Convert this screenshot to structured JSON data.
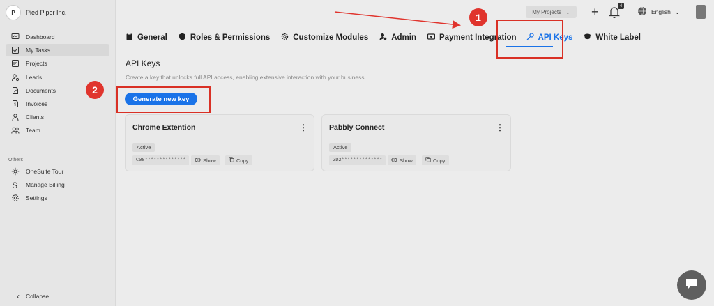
{
  "brand": {
    "logo_text": "P",
    "name": "Pied Piper Inc."
  },
  "sidebar": {
    "items": [
      {
        "label": "Dashboard",
        "icon": "dashboard-icon"
      },
      {
        "label": "My Tasks",
        "icon": "tasks-icon"
      },
      {
        "label": "Projects",
        "icon": "projects-icon"
      },
      {
        "label": "Leads",
        "icon": "leads-icon"
      },
      {
        "label": "Documents",
        "icon": "documents-icon"
      },
      {
        "label": "Invoices",
        "icon": "invoices-icon"
      },
      {
        "label": "Clients",
        "icon": "clients-icon"
      },
      {
        "label": "Team",
        "icon": "team-icon"
      }
    ],
    "others_label": "Others",
    "others": [
      {
        "label": "OneSuite Tour",
        "icon": "sun-icon"
      },
      {
        "label": "Manage Billing",
        "icon": "dollar-icon"
      },
      {
        "label": "Settings",
        "icon": "gear-icon"
      }
    ],
    "collapse_label": "Collapse"
  },
  "topbar": {
    "project_select": "My Projects",
    "notification_count": "4",
    "language": "English"
  },
  "tabs": [
    {
      "label": "General",
      "icon": "clipboard-icon"
    },
    {
      "label": "Roles & Permissions",
      "icon": "shield-icon"
    },
    {
      "label": "Customize Modules",
      "icon": "gear-icon"
    },
    {
      "label": "Admin",
      "icon": "admin-icon"
    },
    {
      "label": "Payment Integration",
      "icon": "payment-icon"
    },
    {
      "label": "API Keys",
      "icon": "key-icon"
    },
    {
      "label": "White Label",
      "icon": "label-icon"
    }
  ],
  "api_keys": {
    "title": "API Keys",
    "description": "Create a key that unlocks full API access, enabling extensive interaction with your business.",
    "generate_label": "Generate new key",
    "cards": [
      {
        "name": "Chrome Extention",
        "status": "Active",
        "key": "C08**************",
        "show_label": "Show",
        "copy_label": "Copy"
      },
      {
        "name": "Pabbly Connect",
        "status": "Active",
        "key": "2D2**************",
        "show_label": "Show",
        "copy_label": "Copy"
      }
    ]
  },
  "annotations": {
    "marker_1": "1",
    "marker_2": "2"
  },
  "colors": {
    "accent": "#1a73e8",
    "highlight": "#d93025",
    "marker": "#e0342d"
  }
}
